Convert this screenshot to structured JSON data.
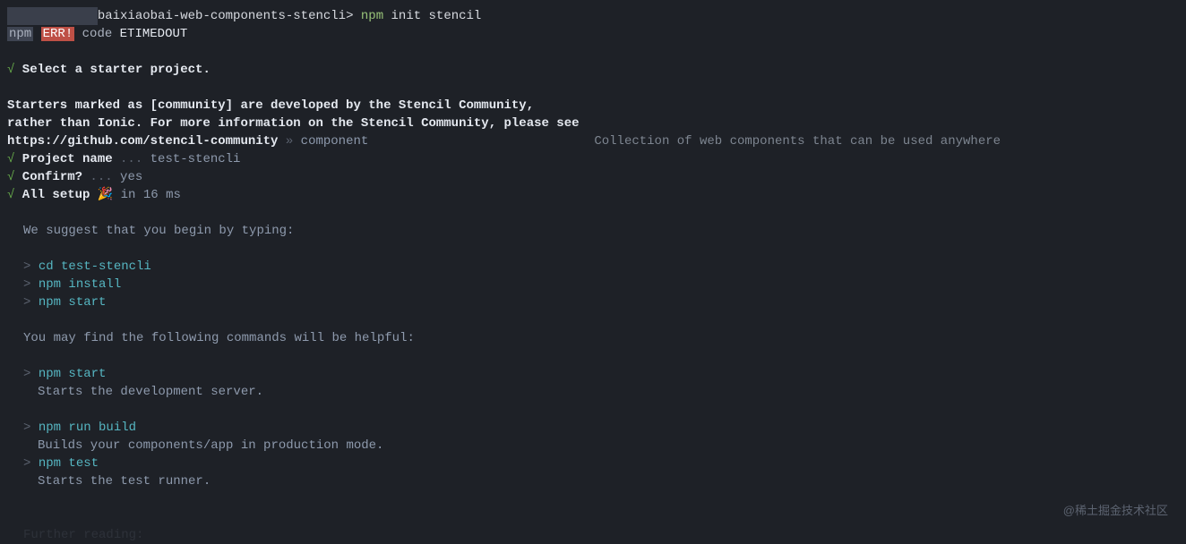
{
  "prompt": {
    "path_prefix": "baixiaobai-web-components-stencli>",
    "command_prefix": "npm",
    "command_rest": " init stencil"
  },
  "npm_err": {
    "npm": "npm",
    "err": "ERR!",
    "code_label": "code",
    "code_value": "ETIMEDOUT"
  },
  "check": "√",
  "select_starter": " Select a starter project.",
  "starters_line1": "Starters marked as [community] are developed by the Stencil Community,",
  "starters_line2": "rather than Ionic. For more information on the Stencil Community, please see",
  "starters_url": "https://github.com/stencil-community",
  "arrow": " » ",
  "component": "component",
  "component_desc": "Collection of web components that can be used anywhere",
  "project_name_label": " Project name",
  "dots": " ... ",
  "project_name_value": "test-stencli",
  "confirm_label": " Confirm?",
  "confirm_value": "yes",
  "all_setup": " All setup",
  "emoji": " 🎉 ",
  "in_ms": "in 16 ms",
  "suggest": "We suggest that you begin by typing:",
  "gt": "> ",
  "cmd_cd": "cd test-stencli",
  "cmd_install": "npm install",
  "cmd_start": "npm start",
  "helpful": "You may find the following commands will be helpful:",
  "cmd_start2": "npm start",
  "start_desc": "Starts the development server.",
  "cmd_build": "npm run build",
  "build_desc": "Builds your components/app in production mode.",
  "cmd_test": "npm test",
  "test_desc": "Starts the test runner.",
  "further": "Further reading:",
  "watermark": "@稀土掘金技术社区",
  "spacer_component": "                              ",
  "redacted": "            "
}
